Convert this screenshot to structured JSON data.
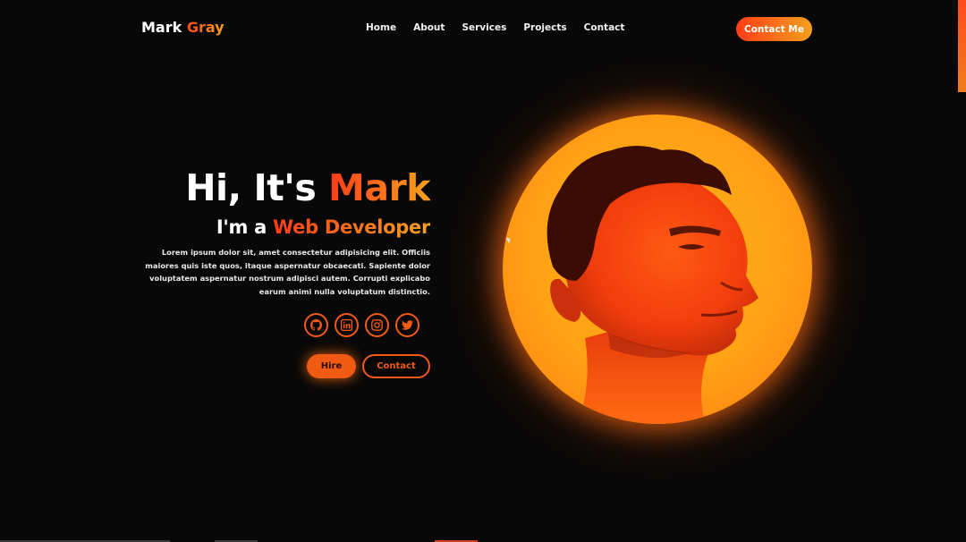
{
  "header": {
    "logo_first": "Mark",
    "logo_accent": "Gray",
    "nav": [
      "Home",
      "About",
      "Services",
      "Projects",
      "Contact"
    ],
    "cta_label": "Contact Me"
  },
  "hero": {
    "greeting": "Hi, It's",
    "name": "Mark",
    "subtitle_prefix": "I'm a",
    "subtitle_role": "Web Developer",
    "description": "Lorem ipsum dolor sit, amet consectetur adipisicing elit. Officiis maiores quis iste quos, itaque aspernatur obcaecati. Sapiente dolor voluptatem aspernatur nostrum adipisci autem. Corrupti explicabo earum animi nulla voluptatum distinctio.",
    "socials": [
      {
        "icon": "github-icon"
      },
      {
        "icon": "linkedin-icon"
      },
      {
        "icon": "instagram-icon"
      },
      {
        "icon": "twitter-icon"
      }
    ],
    "hire_label": "Hire",
    "contact_label": "Contact"
  },
  "colors": {
    "accent_start": "#ff3c18",
    "accent_end": "#f5a11d",
    "background": "#080808"
  }
}
